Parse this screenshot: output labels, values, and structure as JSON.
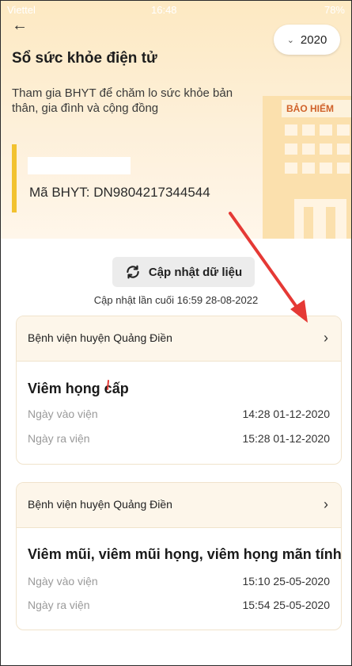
{
  "status_bar": {
    "carrier": "Viettel",
    "time": "16:48",
    "battery": "78%"
  },
  "header": {
    "back_icon": "arrow-left-icon",
    "year": "2020",
    "title": "Sổ sức khỏe điện tử",
    "subtitle": "Tham gia BHYT để chăm lo sức khỏe bản thân, gia đình và cộng đồng",
    "building_sign": "BẢO HIỂM"
  },
  "insurance": {
    "bhyt_label": "Mã BHYT: DN9804217344544"
  },
  "update": {
    "button_label": "Cập nhật dữ liệu",
    "last_update": "Cập nhật lần cuối 16:59 28-08-2022"
  },
  "visits": [
    {
      "hospital": "Bệnh viện huyện Quảng Điền",
      "diagnosis": "Viêm họng cấp",
      "admit_label": "Ngày vào viện",
      "admit_value": "14:28 01-12-2020",
      "discharge_label": "Ngày ra viện",
      "discharge_value": "15:28 01-12-2020"
    },
    {
      "hospital": "Bệnh viện huyện Quảng Điền",
      "diagnosis": "Viêm mũi, viêm mũi họng, viêm họng mãn tính",
      "admit_label": "Ngày vào viện",
      "admit_value": "15:10 25-05-2020",
      "discharge_label": "Ngày ra viện",
      "discharge_value": "15:54 25-05-2020"
    }
  ],
  "colors": {
    "accent_yellow": "#f2c230",
    "annotation_red": "#e53935",
    "hero_bg": "#fde9c2"
  }
}
